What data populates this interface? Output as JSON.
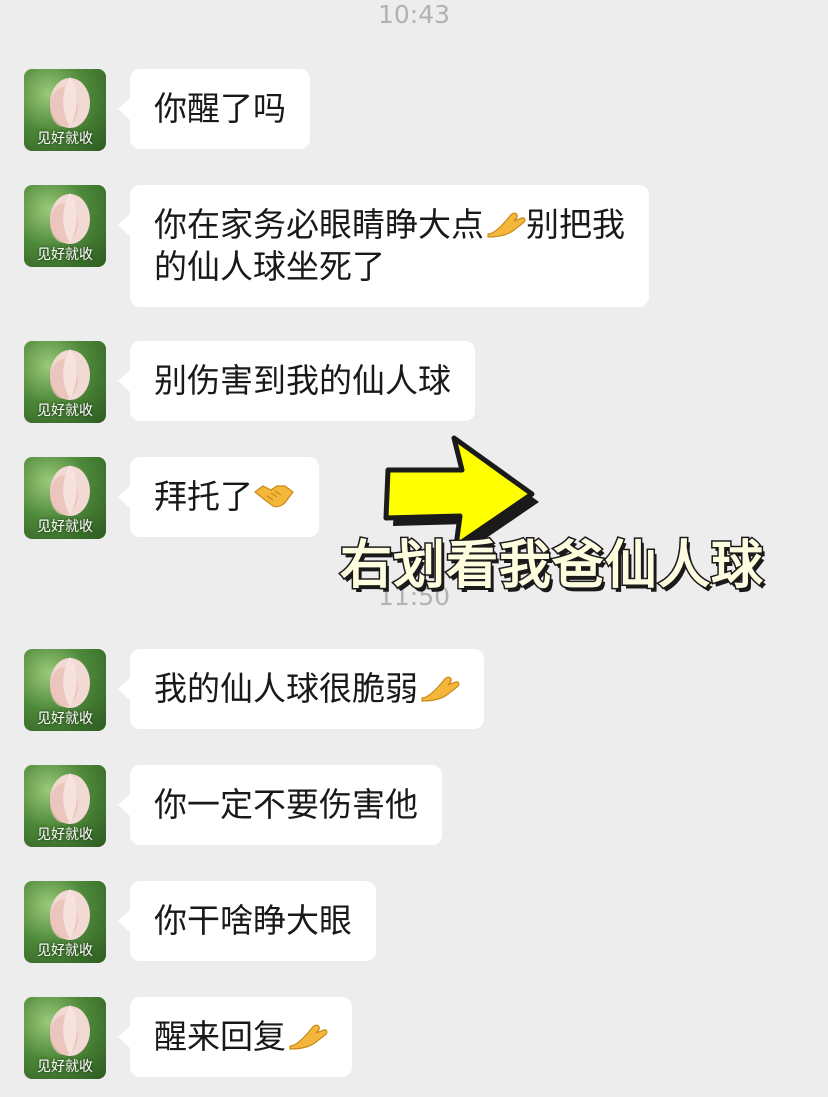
{
  "timestamps": [
    "10:43",
    "11:50"
  ],
  "contact": {
    "avatar_caption": "见好就收",
    "avatar_icon": "lotus-bud-avatar"
  },
  "messages": [
    {
      "lines": [
        "你醒了吗"
      ],
      "emoji": null
    },
    {
      "lines": [
        "你在家务必眼睛睁大点",
        "别把我",
        "的仙人球坐死了"
      ],
      "emoji": "pinching-hand"
    },
    {
      "lines": [
        "别伤害到我的仙人球"
      ],
      "emoji": null
    },
    {
      "lines": [
        "拜托了"
      ],
      "emoji": "handshake"
    },
    {
      "lines": [
        "我的仙人球很脆弱"
      ],
      "emoji": "pinching-hand"
    },
    {
      "lines": [
        "你一定不要伤害他"
      ],
      "emoji": null
    },
    {
      "lines": [
        "你干啥睁大眼"
      ],
      "emoji": null
    },
    {
      "lines": [
        "醒来回复"
      ],
      "emoji": "pinching-hand"
    }
  ],
  "overlay": {
    "caption": "右划看我爸仙人球",
    "arrow_icon": "yellow-right-arrow",
    "arrow_color": "#ffff00",
    "caption_color": "#fffde0"
  },
  "colors": {
    "background": "#ededed",
    "bubble": "#ffffff",
    "text": "#191919",
    "timestamp": "#b2b2b2"
  }
}
